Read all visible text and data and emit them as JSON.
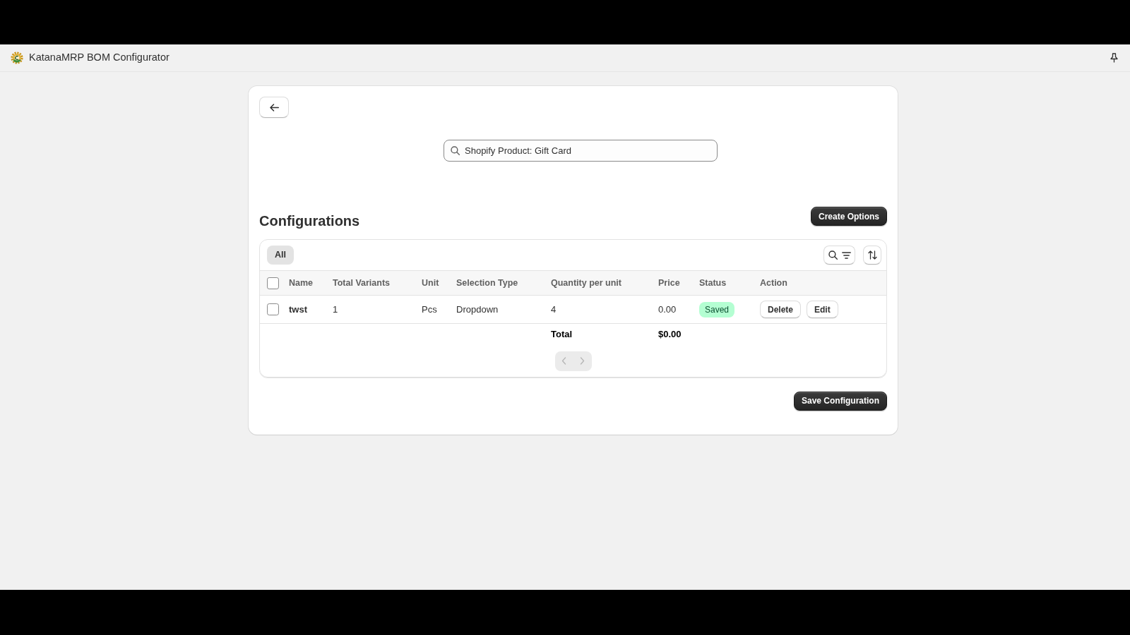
{
  "app_bar": {
    "title": "KatanaMRP BOM Configurator"
  },
  "search": {
    "value": "Shopify Product: Gift Card"
  },
  "section": {
    "title": "Configurations",
    "primary_action": "Create Options"
  },
  "tabs": [
    {
      "label": "All",
      "selected": true
    }
  ],
  "table": {
    "header_checkbox": {
      "checked": false
    },
    "columns": [
      "Name",
      "Total Variants",
      "Unit",
      "Selection Type",
      "Quantity per unit",
      "Price",
      "Status",
      "Action"
    ],
    "rows": [
      {
        "checked": false,
        "name": "twst",
        "total_variants": "1",
        "unit": "Pcs",
        "selection_type": "Dropdown",
        "quantity_per_unit": "4",
        "price": "0.00",
        "status": {
          "label": "Saved",
          "kind": "success"
        },
        "actions": [
          "Delete",
          "Edit"
        ]
      }
    ],
    "total": {
      "label": "Total",
      "value": "$0.00"
    }
  },
  "pagination": [
    {
      "kind": "previous",
      "disabled": true
    },
    {
      "kind": "next",
      "disabled": true
    }
  ],
  "footer_action": "Save Configuration"
}
